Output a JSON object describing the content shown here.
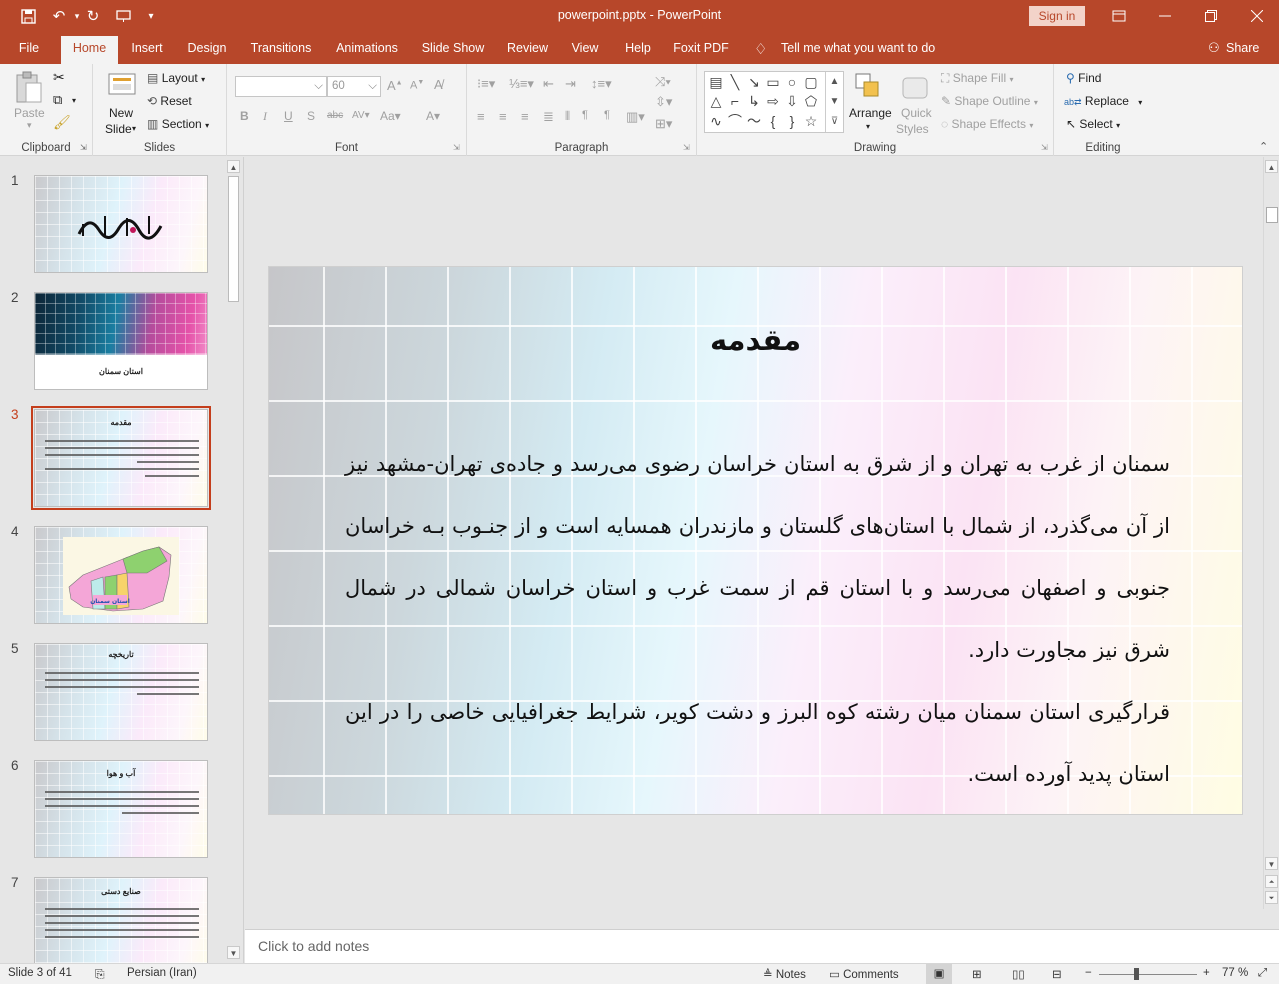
{
  "titlebar": {
    "doc_title": "powerpoint.pptx  -  PowerPoint",
    "sign_in": "Sign in"
  },
  "tabs": [
    "File",
    "Home",
    "Insert",
    "Design",
    "Transitions",
    "Animations",
    "Slide Show",
    "Review",
    "View",
    "Help",
    "Foxit PDF"
  ],
  "active_tab": "Home",
  "tell_me": "Tell me what you want to do",
  "share": "Share",
  "ribbon": {
    "clipboard": {
      "label": "Clipboard",
      "paste": "Paste"
    },
    "slides": {
      "label": "Slides",
      "new_slide_1": "New",
      "new_slide_2": "Slide",
      "layout": "Layout",
      "reset": "Reset",
      "section": "Section"
    },
    "font": {
      "label": "Font",
      "size": "60"
    },
    "paragraph": {
      "label": "Paragraph"
    },
    "drawing": {
      "label": "Drawing",
      "arrange": "Arrange",
      "quick_styles_1": "Quick",
      "quick_styles_2": "Styles",
      "shape_fill": "Shape Fill",
      "shape_outline": "Shape Outline",
      "shape_effects": "Shape Effects"
    },
    "editing": {
      "label": "Editing",
      "find": "Find",
      "replace": "Replace",
      "select": "Select"
    }
  },
  "thumbnails": [
    {
      "num": "1",
      "title": ""
    },
    {
      "num": "2",
      "title": "استان سمنان"
    },
    {
      "num": "3",
      "title": "مقدمه"
    },
    {
      "num": "4",
      "title": "استان سمنان"
    },
    {
      "num": "5",
      "title": "تاریخچه"
    },
    {
      "num": "6",
      "title": "آب و هوا"
    },
    {
      "num": "7",
      "title": "صنایع دستی"
    }
  ],
  "selected_slide": "3",
  "slide": {
    "title": "مقدمه",
    "para1": "سمنان از غرب به تهران و از شرق به استان خراسان رضوی می‌رسد و جاده‌ی تهران-مشهد نیز از آن می‌گذرد، از شمال با استان‌های گلستان و مازندران همسایه است و از جنـوب بـه خراسان جنوبی و اصفهان می‌رسد و با استان قم از سمت غرب و استان خراسان شمالی در شمال شرق نیز مجاورت دارد.",
    "para2": "قرارگیری استان سمنان میان رشته کوه البرز و دشت کویر، شرایط جغرافیایی خاصی را در این استان پدید آورده است."
  },
  "notes_placeholder": "Click to add notes",
  "status": {
    "slide_info": "Slide 3 of 41",
    "language": "Persian (Iran)",
    "notes": "Notes",
    "comments": "Comments",
    "zoom": "77 %",
    "zoom_level_percent": 77
  }
}
